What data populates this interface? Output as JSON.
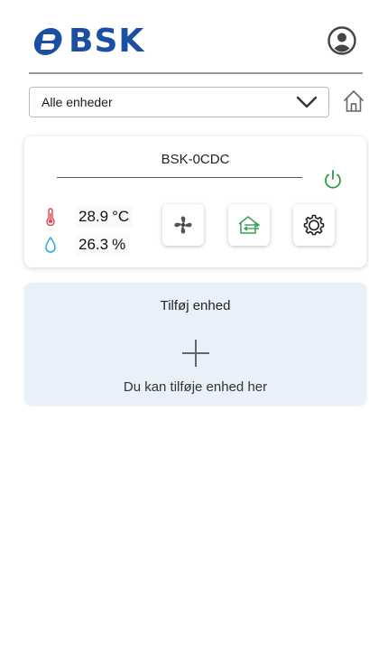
{
  "header": {
    "logo_text": "BSK",
    "brand_color": "#1c4ea3",
    "account_icon": "account-circle-icon"
  },
  "selector": {
    "value": "Alle enheder",
    "chevron_icon": "chevron-down-icon",
    "home_icon": "home-icon"
  },
  "device": {
    "name": "BSK-0CDC",
    "power_icon": "power-icon",
    "power_color": "#2e9a3e",
    "temperature": {
      "value": "28.9",
      "unit": "°C",
      "icon": "thermometer-icon"
    },
    "humidity": {
      "value": "26.3",
      "unit": "%",
      "icon": "water-drop-icon"
    },
    "controls": [
      {
        "name": "fan-button",
        "icon": "fan-icon"
      },
      {
        "name": "house-button",
        "icon": "house-ventilation-icon"
      },
      {
        "name": "settings-button",
        "icon": "gear-icon"
      }
    ]
  },
  "add_device": {
    "title": "Tilføj enhed",
    "subtitle": "Du kan tilføje enhed her",
    "icon": "plus-icon",
    "background": "#e8f1fa"
  }
}
